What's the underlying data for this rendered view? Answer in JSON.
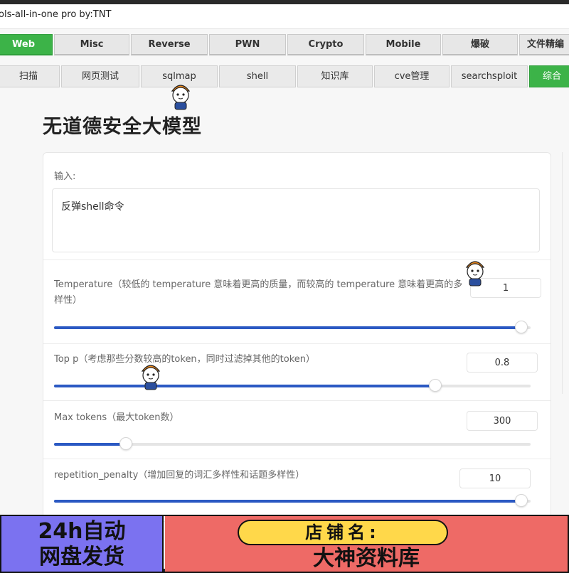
{
  "window": {
    "title": "ols-all-in-one pro   by:TNT"
  },
  "tabs_primary": [
    "Web",
    "Misc",
    "Reverse",
    "PWN",
    "Crypto",
    "Mobile",
    "爆破",
    "文件精编"
  ],
  "tabs_secondary": [
    "扫描",
    "网页测试",
    "sqlmap",
    "shell",
    "知识库",
    "cve管理",
    "searchsploit",
    "综合"
  ],
  "page_title": "无道德安全大模型",
  "input": {
    "label": "输入:",
    "value": "反弹shell命令"
  },
  "params": [
    {
      "label": "Temperature（较低的 temperature 意味着更高的质量，而较高的 temperature 意味着更高的多样性）",
      "value": "1",
      "fraction": 0.98
    },
    {
      "label": "Top p（考虑那些分数较高的token，同时过滤掉其他的token）",
      "value": "0.8",
      "fraction": 0.8
    },
    {
      "label": "Max tokens（最大token数）",
      "value": "300",
      "fraction": 0.15
    },
    {
      "label": "repetition_penalty（增加回复的词汇多样性和话题多样性）",
      "value": "10",
      "fraction": 0.98
    }
  ],
  "footer": {
    "left_line1": "24h自动",
    "left_line2": "网盘发货",
    "shop_label": "店铺名:",
    "shop_name": "大神资料库"
  },
  "colors": {
    "accent_green": "#3cb348",
    "slider_blue": "#2b59c3",
    "footer_purple": "#7b72f0",
    "footer_red": "#ee6a66",
    "footer_yellow": "#ffd84a"
  }
}
